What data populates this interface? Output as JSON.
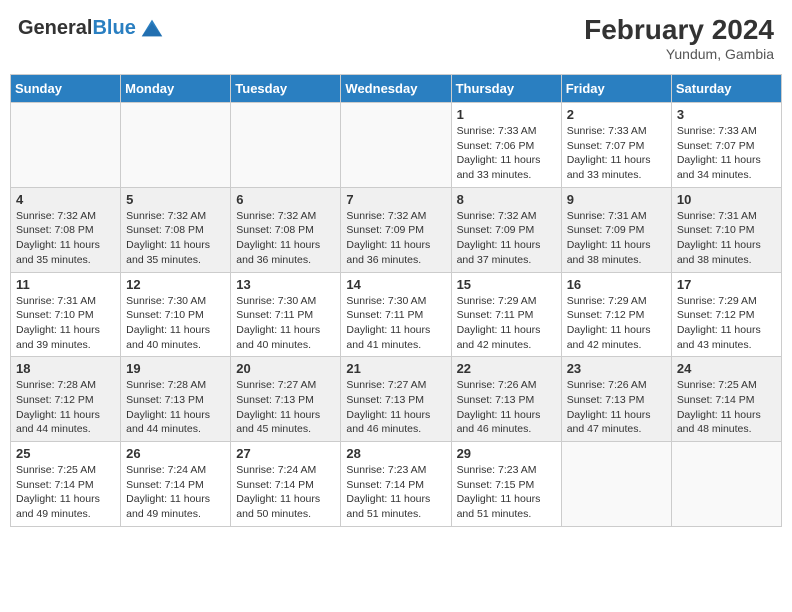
{
  "header": {
    "logo_line1": "General",
    "logo_line2": "Blue",
    "month_year": "February 2024",
    "location": "Yundum, Gambia"
  },
  "days_of_week": [
    "Sunday",
    "Monday",
    "Tuesday",
    "Wednesday",
    "Thursday",
    "Friday",
    "Saturday"
  ],
  "weeks": [
    [
      {
        "day": "",
        "info": ""
      },
      {
        "day": "",
        "info": ""
      },
      {
        "day": "",
        "info": ""
      },
      {
        "day": "",
        "info": ""
      },
      {
        "day": "1",
        "info": "Sunrise: 7:33 AM\nSunset: 7:06 PM\nDaylight: 11 hours and 33 minutes."
      },
      {
        "day": "2",
        "info": "Sunrise: 7:33 AM\nSunset: 7:07 PM\nDaylight: 11 hours and 33 minutes."
      },
      {
        "day": "3",
        "info": "Sunrise: 7:33 AM\nSunset: 7:07 PM\nDaylight: 11 hours and 34 minutes."
      }
    ],
    [
      {
        "day": "4",
        "info": "Sunrise: 7:32 AM\nSunset: 7:08 PM\nDaylight: 11 hours and 35 minutes."
      },
      {
        "day": "5",
        "info": "Sunrise: 7:32 AM\nSunset: 7:08 PM\nDaylight: 11 hours and 35 minutes."
      },
      {
        "day": "6",
        "info": "Sunrise: 7:32 AM\nSunset: 7:08 PM\nDaylight: 11 hours and 36 minutes."
      },
      {
        "day": "7",
        "info": "Sunrise: 7:32 AM\nSunset: 7:09 PM\nDaylight: 11 hours and 36 minutes."
      },
      {
        "day": "8",
        "info": "Sunrise: 7:32 AM\nSunset: 7:09 PM\nDaylight: 11 hours and 37 minutes."
      },
      {
        "day": "9",
        "info": "Sunrise: 7:31 AM\nSunset: 7:09 PM\nDaylight: 11 hours and 38 minutes."
      },
      {
        "day": "10",
        "info": "Sunrise: 7:31 AM\nSunset: 7:10 PM\nDaylight: 11 hours and 38 minutes."
      }
    ],
    [
      {
        "day": "11",
        "info": "Sunrise: 7:31 AM\nSunset: 7:10 PM\nDaylight: 11 hours and 39 minutes."
      },
      {
        "day": "12",
        "info": "Sunrise: 7:30 AM\nSunset: 7:10 PM\nDaylight: 11 hours and 40 minutes."
      },
      {
        "day": "13",
        "info": "Sunrise: 7:30 AM\nSunset: 7:11 PM\nDaylight: 11 hours and 40 minutes."
      },
      {
        "day": "14",
        "info": "Sunrise: 7:30 AM\nSunset: 7:11 PM\nDaylight: 11 hours and 41 minutes."
      },
      {
        "day": "15",
        "info": "Sunrise: 7:29 AM\nSunset: 7:11 PM\nDaylight: 11 hours and 42 minutes."
      },
      {
        "day": "16",
        "info": "Sunrise: 7:29 AM\nSunset: 7:12 PM\nDaylight: 11 hours and 42 minutes."
      },
      {
        "day": "17",
        "info": "Sunrise: 7:29 AM\nSunset: 7:12 PM\nDaylight: 11 hours and 43 minutes."
      }
    ],
    [
      {
        "day": "18",
        "info": "Sunrise: 7:28 AM\nSunset: 7:12 PM\nDaylight: 11 hours and 44 minutes."
      },
      {
        "day": "19",
        "info": "Sunrise: 7:28 AM\nSunset: 7:13 PM\nDaylight: 11 hours and 44 minutes."
      },
      {
        "day": "20",
        "info": "Sunrise: 7:27 AM\nSunset: 7:13 PM\nDaylight: 11 hours and 45 minutes."
      },
      {
        "day": "21",
        "info": "Sunrise: 7:27 AM\nSunset: 7:13 PM\nDaylight: 11 hours and 46 minutes."
      },
      {
        "day": "22",
        "info": "Sunrise: 7:26 AM\nSunset: 7:13 PM\nDaylight: 11 hours and 46 minutes."
      },
      {
        "day": "23",
        "info": "Sunrise: 7:26 AM\nSunset: 7:13 PM\nDaylight: 11 hours and 47 minutes."
      },
      {
        "day": "24",
        "info": "Sunrise: 7:25 AM\nSunset: 7:14 PM\nDaylight: 11 hours and 48 minutes."
      }
    ],
    [
      {
        "day": "25",
        "info": "Sunrise: 7:25 AM\nSunset: 7:14 PM\nDaylight: 11 hours and 49 minutes."
      },
      {
        "day": "26",
        "info": "Sunrise: 7:24 AM\nSunset: 7:14 PM\nDaylight: 11 hours and 49 minutes."
      },
      {
        "day": "27",
        "info": "Sunrise: 7:24 AM\nSunset: 7:14 PM\nDaylight: 11 hours and 50 minutes."
      },
      {
        "day": "28",
        "info": "Sunrise: 7:23 AM\nSunset: 7:14 PM\nDaylight: 11 hours and 51 minutes."
      },
      {
        "day": "29",
        "info": "Sunrise: 7:23 AM\nSunset: 7:15 PM\nDaylight: 11 hours and 51 minutes."
      },
      {
        "day": "",
        "info": ""
      },
      {
        "day": "",
        "info": ""
      }
    ]
  ]
}
